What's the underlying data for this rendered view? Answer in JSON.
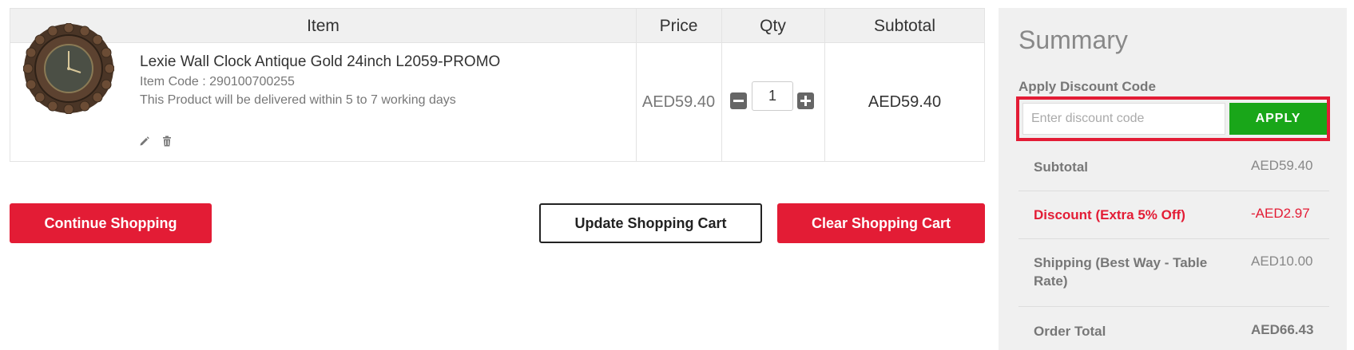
{
  "cart_table": {
    "headers": {
      "item": "Item",
      "price": "Price",
      "qty": "Qty",
      "subtotal": "Subtotal"
    },
    "row": {
      "product_name": "Lexie Wall Clock Antique Gold 24inch L2059-PROMO",
      "item_code_label": "Item Code : ",
      "item_code": "290100700255",
      "delivery_note": "This Product will be delivered within 5 to 7 working days",
      "price": "AED59.40",
      "qty": "1",
      "subtotal": "AED59.40"
    }
  },
  "actions": {
    "continue_shopping": "Continue Shopping",
    "update_cart": "Update Shopping Cart",
    "clear_cart": "Clear Shopping Cart"
  },
  "summary": {
    "title": "Summary",
    "discount_label": "Apply Discount Code",
    "discount_placeholder": "Enter discount code",
    "apply_label": "APPLY",
    "rows": {
      "subtotal_label": "Subtotal",
      "subtotal_value": "AED59.40",
      "discount_label": "Discount (Extra 5% Off)",
      "discount_value": "-AED2.97",
      "shipping_label": "Shipping (Best Way - Table Rate)",
      "shipping_value": "AED10.00",
      "total_label": "Order Total",
      "total_value": "AED66.43"
    }
  },
  "colors": {
    "brand_red": "#e31c35",
    "apply_green": "#19a619",
    "summary_bg": "#f0f0f0"
  },
  "icons": {
    "edit": "pencil-icon",
    "delete": "trash-icon",
    "decrease": "minus-icon",
    "increase": "plus-icon"
  }
}
